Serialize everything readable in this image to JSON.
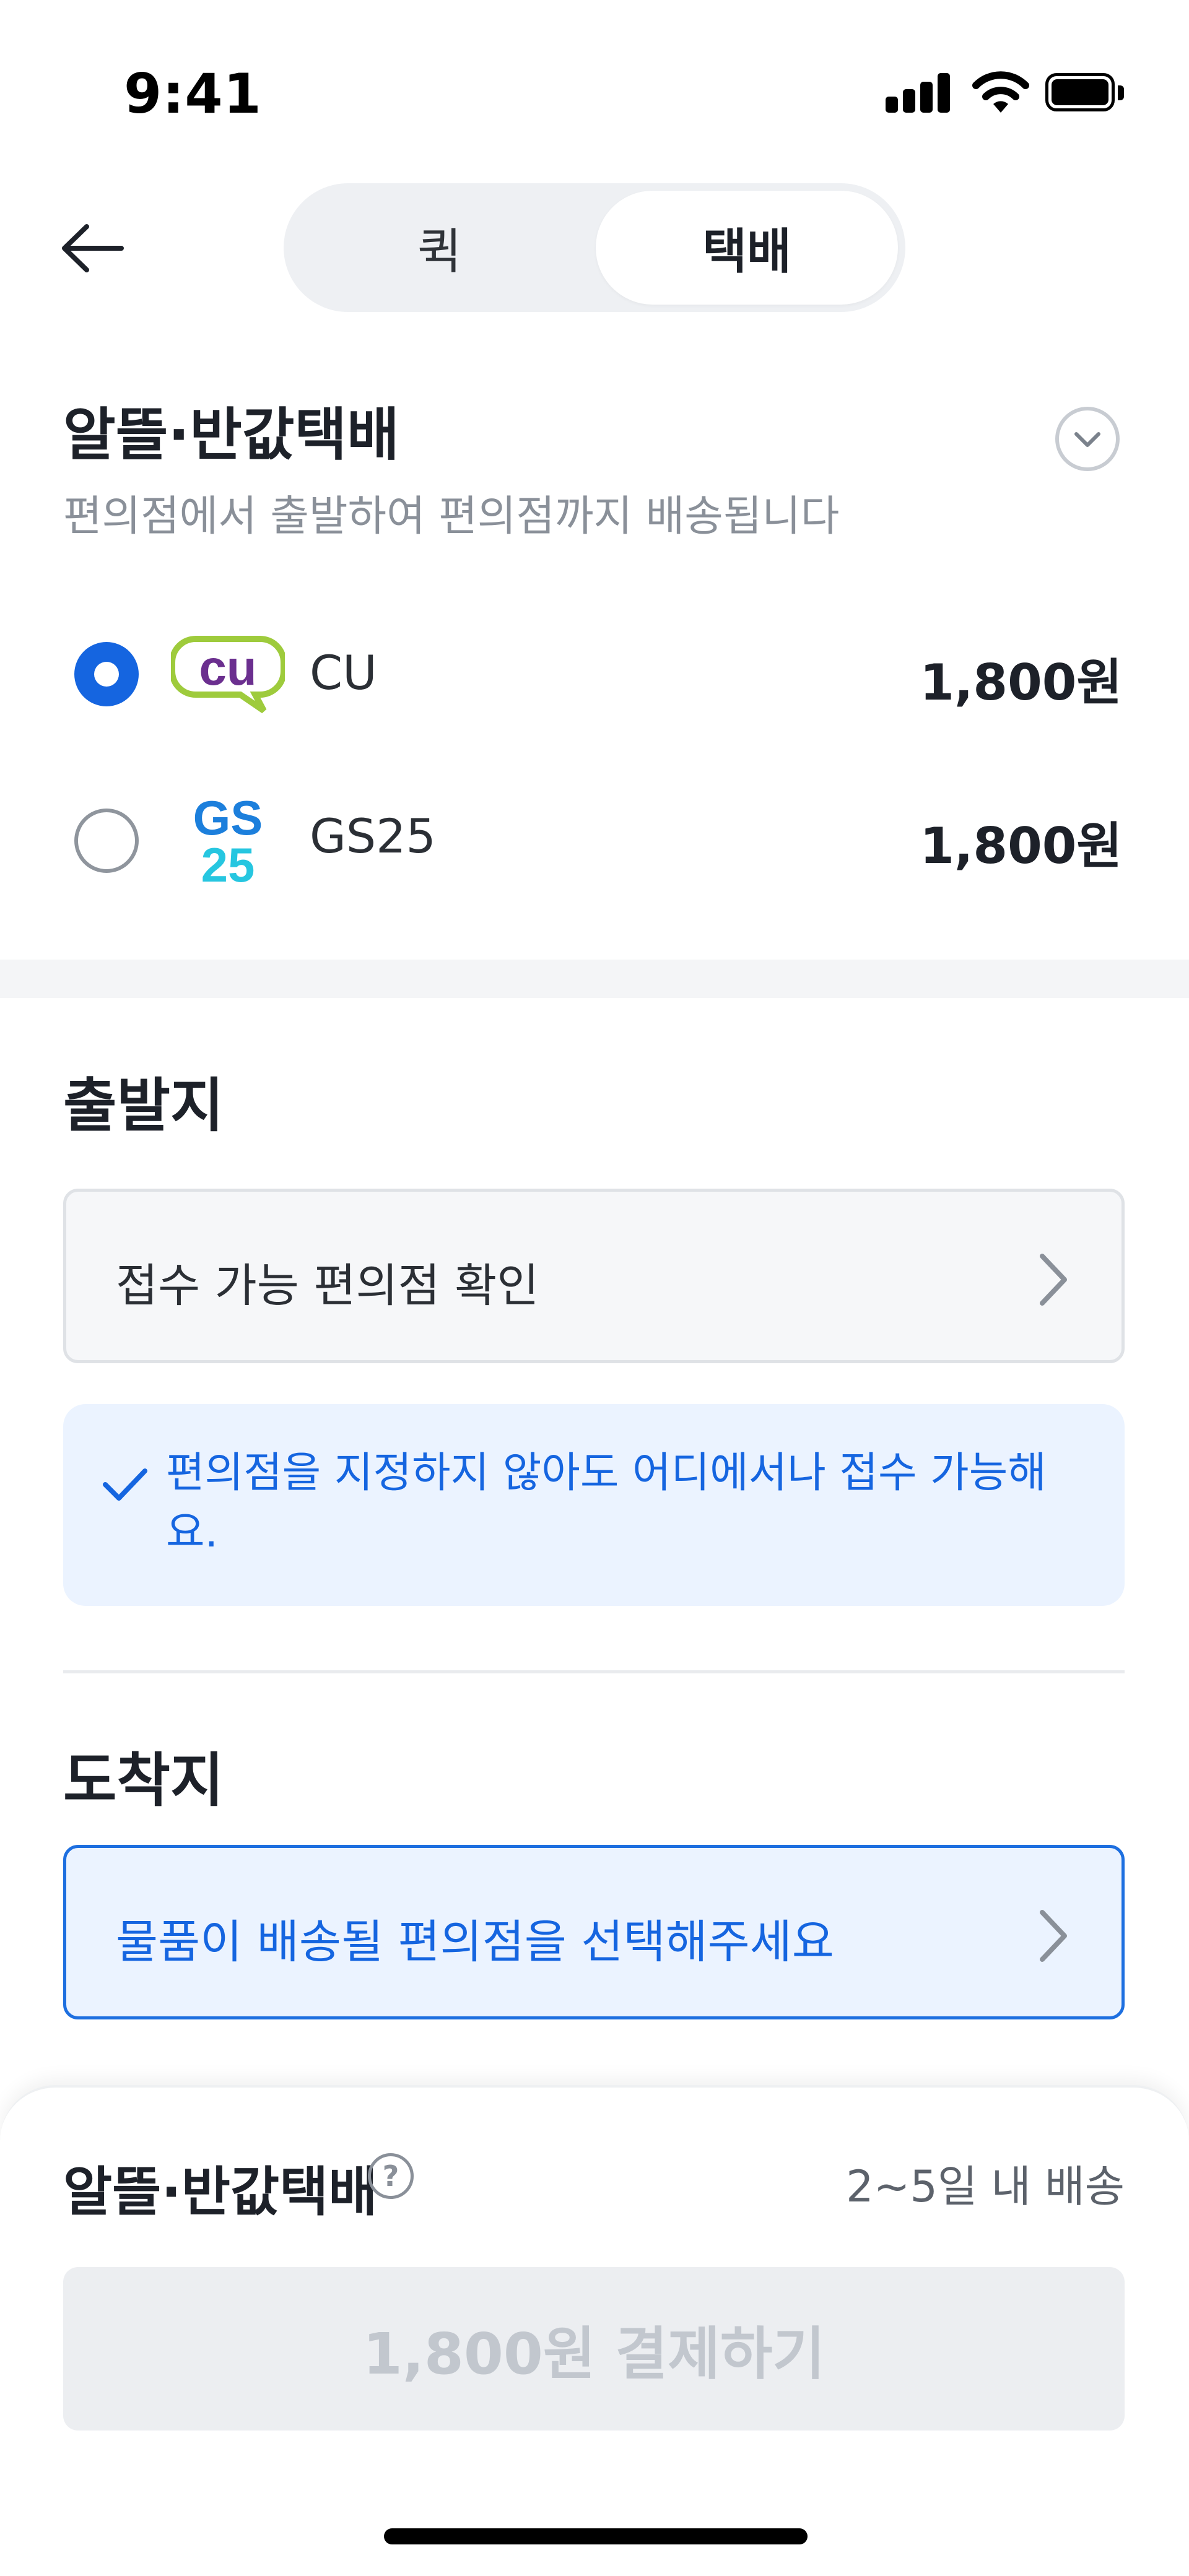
{
  "status_bar": {
    "time": "9:41"
  },
  "tabs": [
    {
      "label": "퀵",
      "selected": false
    },
    {
      "label": "택배",
      "selected": true
    }
  ],
  "service": {
    "title": "알뜰·반값택배",
    "subtitle": "편의점에서 출발하여 편의점까지 배송됩니다",
    "options": [
      {
        "name": "CU",
        "price": "1,800원",
        "selected": true,
        "logo_text": "cu"
      },
      {
        "name": "GS25",
        "price": "1,800원",
        "selected": false,
        "logo_text": "GS25"
      }
    ]
  },
  "departure": {
    "title": "출발지",
    "field_label": "접수 가능 편의점 확인",
    "notice": "편의점을 지정하지 않아도 어디에서나 접수 가능해요."
  },
  "arrival": {
    "title": "도착지",
    "field_label": "물품이 배송될 편의점을 선택해주세요"
  },
  "sheet": {
    "title": "알뜰·반값택배",
    "help_icon": "?",
    "eta": "2~5일 내 배송",
    "pay_button": "1,800원 결제하기"
  },
  "colors": {
    "accent": "#1565e0",
    "cu_purple": "#6b2f8f",
    "cu_green": "#9ecb3c",
    "gs_blue": "#1c7fdc",
    "gs_cyan": "#26c6e0"
  }
}
